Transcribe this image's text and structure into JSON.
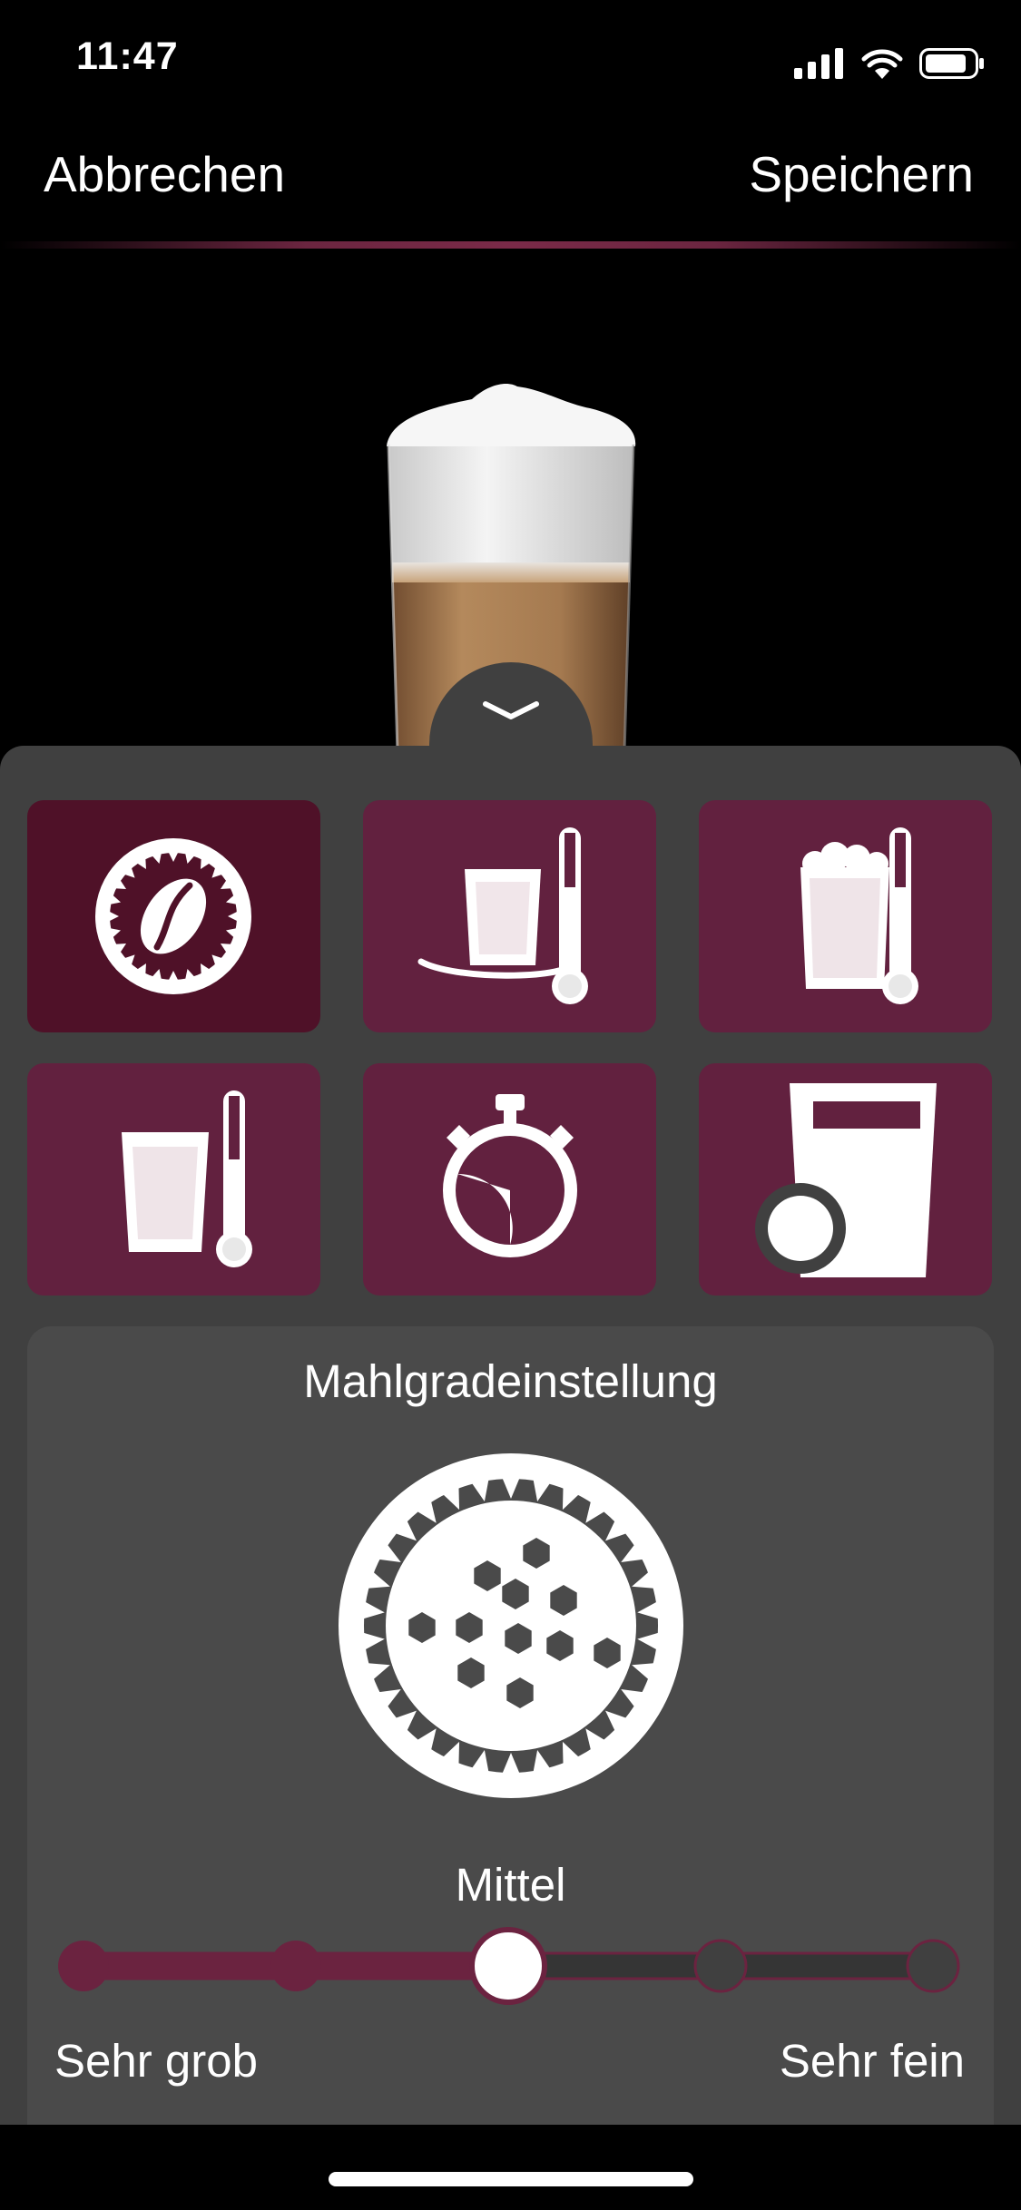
{
  "status": {
    "time": "11:47"
  },
  "header": {
    "cancel_label": "Abbrechen",
    "save_label": "Speichern"
  },
  "tiles": [
    {
      "icon": "grinder-bean-icon",
      "active": true
    },
    {
      "icon": "cup-warmer-temperature-icon",
      "active": false
    },
    {
      "icon": "milk-foam-temperature-icon",
      "active": false
    },
    {
      "icon": "coffee-temperature-icon",
      "active": false
    },
    {
      "icon": "stopwatch-icon",
      "active": false
    },
    {
      "icon": "cup-size-icon",
      "active": false
    }
  ],
  "detail": {
    "title": "Mahlgradeinstellung",
    "icon": "grinder-grind-icon",
    "level_label": "Mittel",
    "level_index": 2,
    "level_count": 5,
    "min_label": "Sehr grob",
    "max_label": "Sehr fein"
  },
  "colors": {
    "accent": "#6b2340",
    "tile": "#62213f",
    "tile_active": "#4f1128",
    "sheet": "#404040",
    "panel": "#4a4a4a"
  }
}
